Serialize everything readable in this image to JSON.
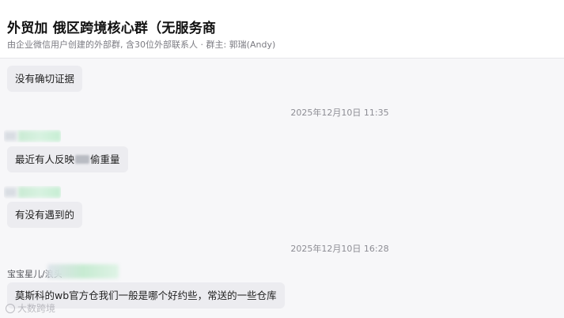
{
  "header": {
    "title": "外贸加 俄区跨境核心群（无服务商",
    "subtitle": "由企业微信用户创建的外部群, 含30位外部联系人 · 群主: 郭瑞(Andy)"
  },
  "messages": [
    {
      "text": "没有确切证据"
    },
    {
      "timestamp": "2025年12月10日 11:35"
    },
    {
      "text_before": "最近有人反映",
      "text_after": "偷重量"
    },
    {
      "text": "有没有遇到的"
    },
    {
      "timestamp": "2025年12月10日 16:28"
    },
    {
      "sender": "宝宝星儿/浪头",
      "text": "莫斯科的wb官方仓我们一般是哪个好约些，常送的一些仓库"
    }
  ],
  "watermark": "大数跨境",
  "icons": {
    "watermark_logo": "circle-logo-icon"
  }
}
